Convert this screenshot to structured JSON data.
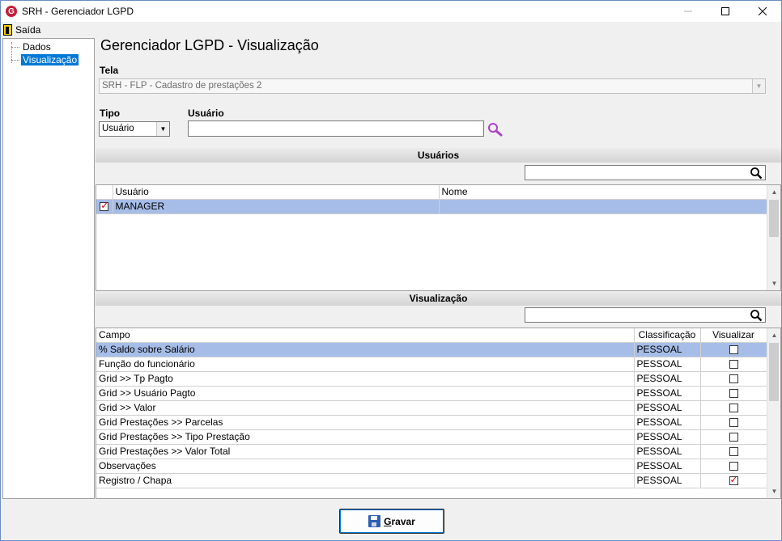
{
  "window": {
    "title": "SRH - Gerenciador LGPD",
    "app_icon_letter": "G"
  },
  "menu": {
    "exit_label": "Saída"
  },
  "tree": {
    "items": [
      {
        "label": "Dados"
      },
      {
        "label": "Visualização",
        "selected": true
      }
    ]
  },
  "page": {
    "title": "Gerenciador LGPD - Visualização"
  },
  "tela": {
    "label": "Tela",
    "value": "SRH - FLP - Cadastro de prestações 2"
  },
  "tipo": {
    "label": "Tipo",
    "value": "Usuário"
  },
  "usuario": {
    "label": "Usuário",
    "value": ""
  },
  "usuarios_section": {
    "title": "Usuários",
    "search_value": "",
    "columns": [
      "Usuário",
      "Nome"
    ],
    "rows": [
      {
        "checked": true,
        "usuario": "MANAGER",
        "nome": ""
      }
    ]
  },
  "visualizacao_section": {
    "title": "Visualização",
    "search_value": "",
    "columns": [
      "Campo",
      "Classificação",
      "Visualizar"
    ],
    "rows": [
      {
        "campo": "% Saldo sobre Salário",
        "classificacao": "PESSOAL",
        "visualizar": false
      },
      {
        "campo": "Função do funcionário",
        "classificacao": "PESSOAL",
        "visualizar": false
      },
      {
        "campo": "Grid >> Tp Pagto",
        "classificacao": "PESSOAL",
        "visualizar": false
      },
      {
        "campo": "Grid >> Usuário Pagto",
        "classificacao": "PESSOAL",
        "visualizar": false
      },
      {
        "campo": "Grid >> Valor",
        "classificacao": "PESSOAL",
        "visualizar": false
      },
      {
        "campo": "Grid Prestações >> Parcelas",
        "classificacao": "PESSOAL",
        "visualizar": false
      },
      {
        "campo": "Grid Prestações >> Tipo Prestação",
        "classificacao": "PESSOAL",
        "visualizar": false
      },
      {
        "campo": "Grid Prestações >> Valor Total",
        "classificacao": "PESSOAL",
        "visualizar": false
      },
      {
        "campo": "Observações",
        "classificacao": "PESSOAL",
        "visualizar": false
      },
      {
        "campo": "Registro / Chapa",
        "classificacao": "PESSOAL",
        "visualizar": true
      }
    ]
  },
  "footer": {
    "save_label": "Gravar",
    "save_mnemonic": "G",
    "save_rest": "ravar"
  },
  "colors": {
    "selection": "#a6bde8",
    "accent": "#0078d7",
    "check": "#dd0000",
    "search_icon_purple": "#b040c8"
  }
}
